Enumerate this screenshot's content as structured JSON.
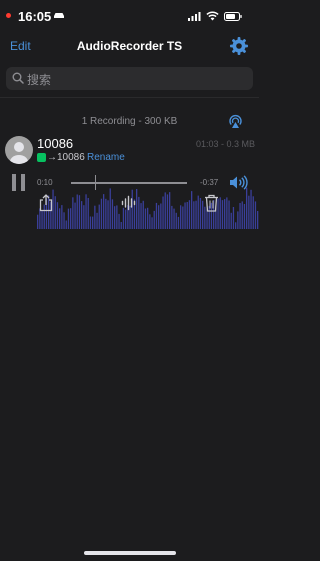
{
  "status_bar": {
    "time": "16:05"
  },
  "nav": {
    "edit_label": "Edit",
    "title": "AudioRecorder TS"
  },
  "search": {
    "placeholder": "搜索"
  },
  "summary": {
    "text": "1 Recording - 300 KB"
  },
  "recording": {
    "name": "10086",
    "target": "→10086",
    "rename_label": "Rename",
    "duration_size": "01:03 - 0.3 MB",
    "elapsed": "0:10",
    "remaining": "-0:37",
    "progress_fraction": 0.21
  },
  "colors": {
    "accent": "#4a90d9",
    "background": "#1c1c1e",
    "waveform": "#3a3f9a",
    "record_dot": "#ff3b30"
  },
  "icons": [
    "record-dot-icon",
    "car-icon",
    "signal-icon",
    "wifi-icon",
    "battery-icon",
    "gear-icon",
    "search-icon",
    "airplay-icon",
    "avatar-icon",
    "wechat-icon",
    "pause-icon",
    "volume-icon",
    "share-icon",
    "waveform-edit-icon",
    "trash-icon"
  ]
}
